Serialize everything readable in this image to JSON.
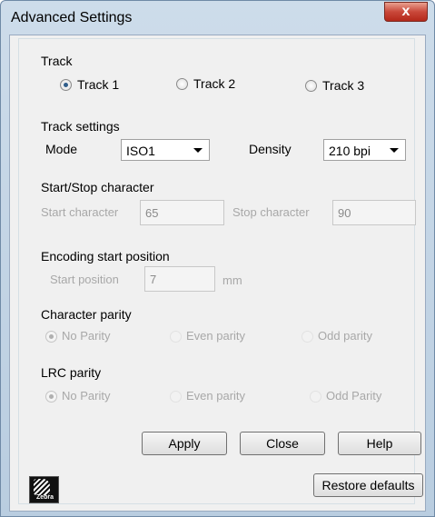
{
  "window": {
    "title": "Advanced Settings",
    "close_glyph": "x"
  },
  "track": {
    "label": "Track",
    "options": [
      {
        "label": "Track 1",
        "selected": true
      },
      {
        "label": "Track 2",
        "selected": false
      },
      {
        "label": "Track 3",
        "selected": false
      }
    ]
  },
  "track_settings": {
    "label": "Track settings",
    "mode_label": "Mode",
    "mode_value": "ISO1",
    "density_label": "Density",
    "density_value": "210 bpi"
  },
  "start_stop": {
    "label": "Start/Stop character",
    "start_label": "Start character",
    "start_value": "65",
    "stop_label": "Stop character",
    "stop_value": "90"
  },
  "encoding": {
    "label": "Encoding start position",
    "start_label": "Start position",
    "start_value": "7",
    "unit": "mm"
  },
  "character_parity": {
    "label": "Character parity",
    "options": [
      {
        "label": "No Parity",
        "selected": true
      },
      {
        "label": "Even parity",
        "selected": false
      },
      {
        "label": "Odd parity",
        "selected": false
      }
    ]
  },
  "lrc_parity": {
    "label": "LRC parity",
    "options": [
      {
        "label": "No Parity",
        "selected": true
      },
      {
        "label": "Even parity",
        "selected": false
      },
      {
        "label": "Odd Parity",
        "selected": false
      }
    ]
  },
  "buttons": {
    "apply": "Apply",
    "close": "Close",
    "help": "Help",
    "restore": "Restore defaults"
  },
  "logo": {
    "text": "Zebra",
    "icon": "zebra-logo-icon"
  },
  "colors": {
    "titlebar": "#c3d5e8",
    "close_button": "#c9483a",
    "dialog_bg": "#f0f0f0",
    "disabled_text": "#a8a8a8"
  }
}
